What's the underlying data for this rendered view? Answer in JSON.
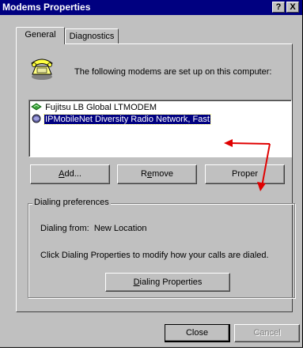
{
  "window": {
    "title": "Modems Properties",
    "help_button": "?",
    "close_button": "X"
  },
  "tabs": [
    {
      "label": "General",
      "active": true
    },
    {
      "label": "Diagnostics",
      "active": false
    }
  ],
  "info": {
    "icon": "telephone-icon",
    "text": "The following modems are set up on this computer:"
  },
  "modems": [
    {
      "name": "Fujitsu LB Global LTMODEM",
      "icon": "modem-icon",
      "selected": false
    },
    {
      "name": "IPMobileNet Diversity Radio Network, Fast",
      "icon": "modem-icon",
      "selected": true
    }
  ],
  "buttons": {
    "add": {
      "mnemonic": "A",
      "rest": "dd..."
    },
    "remove": {
      "before": "R",
      "mnemonic": "e",
      "rest": "move"
    },
    "properties": {
      "label": "Proper"
    }
  },
  "dialing": {
    "group_label": "Dialing preferences",
    "from_label": "Dialing from:",
    "from_value": "New Location",
    "hint": "Click Dialing Properties to modify how your calls are dialed.",
    "button": {
      "mnemonic": "D",
      "rest": "ialing Properties"
    }
  },
  "footer": {
    "close": "Close",
    "cancel": "Cancel"
  },
  "annotation": {
    "color": "#e00000"
  }
}
